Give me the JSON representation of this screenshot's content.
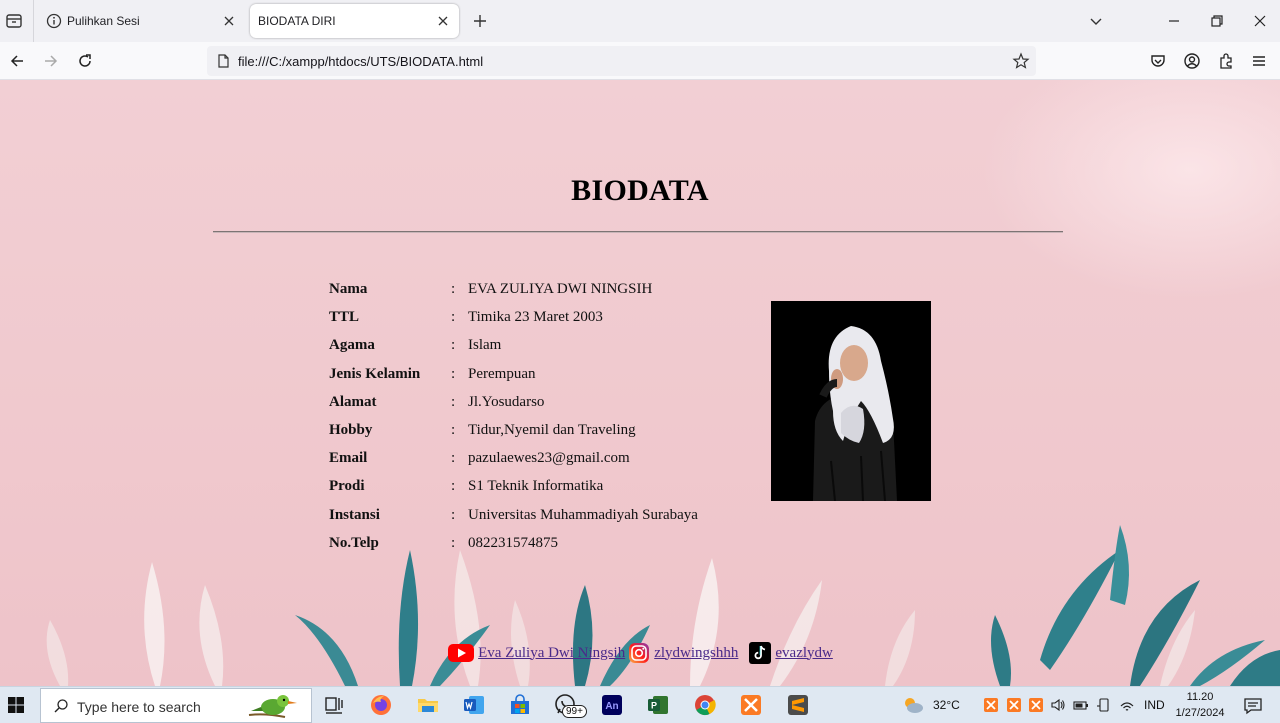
{
  "browser": {
    "tabs": [
      {
        "title": "Pulihkan Sesi",
        "active": false
      },
      {
        "title": "BIODATA DIRI",
        "active": true
      }
    ],
    "url": "file:///C:/xampp/htdocs/UTS/BIODATA.html"
  },
  "page": {
    "title": "BIODATA",
    "rows": [
      {
        "label": "Nama",
        "sep": ":",
        "value": "EVA ZULIYA DWI NINGSIH"
      },
      {
        "label": "TTL",
        "sep": ":",
        "value": "Timika 23 Maret 2003"
      },
      {
        "label": "Agama",
        "sep": ":",
        "value": "Islam"
      },
      {
        "label": "Jenis Kelamin",
        "sep": ":",
        "value": "Perempuan"
      },
      {
        "label": "Alamat",
        "sep": ":",
        "value": "Jl.Yosudarso"
      },
      {
        "label": "Hobby",
        "sep": ":",
        "value": "Tidur,Nyemil dan Traveling"
      },
      {
        "label": "Email",
        "sep": ":",
        "value": "pazulaewes23@gmail.com"
      },
      {
        "label": "Prodi",
        "sep": ":",
        "value": "S1 Teknik Informatika"
      },
      {
        "label": "Instansi",
        "sep": ":",
        "value": "Universitas Muhammadiyah Surabaya"
      },
      {
        "label": "No.Telp",
        "sep": ":",
        "value": "082231574875"
      }
    ],
    "social": {
      "youtube": "Eva Zuliya Dwi Ningsih",
      "instagram": "zlydwingshhh",
      "tiktok": "evazlydw"
    }
  },
  "taskbar": {
    "search_placeholder": "Type here to search",
    "whatsapp_badge": "99+",
    "weather": "32°C",
    "language": "IND",
    "time": "11.20",
    "date": "1/27/2024"
  },
  "colors": {
    "page_background": "#f0c9ce",
    "link": "#4a2a8a",
    "rule": "#7d7474"
  }
}
